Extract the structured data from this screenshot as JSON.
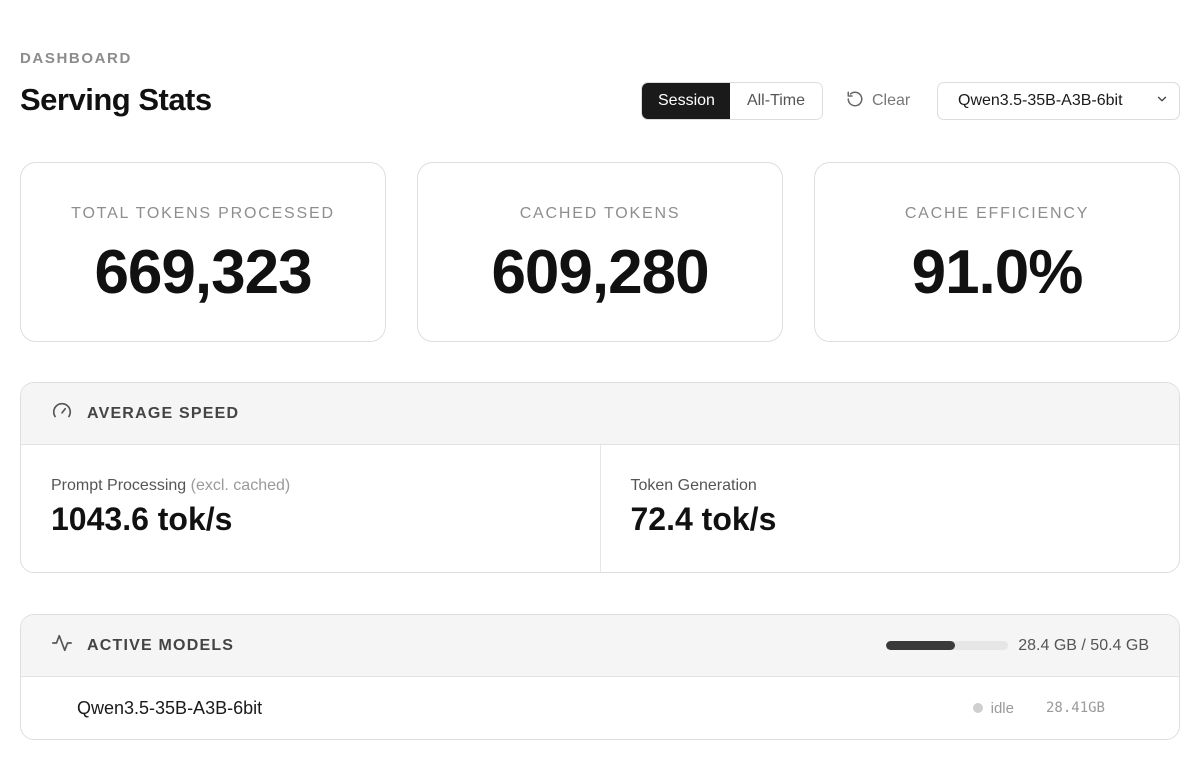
{
  "header": {
    "eyebrow": "DASHBOARD",
    "title": "Serving Stats",
    "toggle": {
      "options": [
        "Session",
        "All-Time"
      ],
      "selected": "Session"
    },
    "clear_label": "Clear",
    "model_select": {
      "value": "Qwen3.5-35B-A3B-6bit"
    }
  },
  "stats": [
    {
      "label": "TOTAL TOKENS PROCESSED",
      "value": "669,323"
    },
    {
      "label": "CACHED TOKENS",
      "value": "609,280"
    },
    {
      "label": "CACHE EFFICIENCY",
      "value": "91.0%"
    }
  ],
  "average_speed": {
    "title": "AVERAGE SPEED",
    "icon": "speedometer-icon",
    "prompt": {
      "label": "Prompt Processing",
      "note": "(excl. cached)",
      "value": "1043.6 tok/s"
    },
    "generation": {
      "label": "Token Generation",
      "value": "72.4 tok/s"
    }
  },
  "active_models": {
    "title": "ACTIVE MODELS",
    "icon": "activity-icon",
    "memory": {
      "text": "28.4 GB / 50.4 GB",
      "used_fraction": 0.5635
    },
    "models": [
      {
        "name": "Qwen3.5-35B-A3B-6bit",
        "status": "idle",
        "size": "28.41GB"
      }
    ]
  },
  "colors": {
    "accent_dark": "#1a1a1a",
    "muted_text": "#8e8e8e",
    "panel_header_bg": "#f5f5f5",
    "idle_dot": "#cfcfcf"
  }
}
